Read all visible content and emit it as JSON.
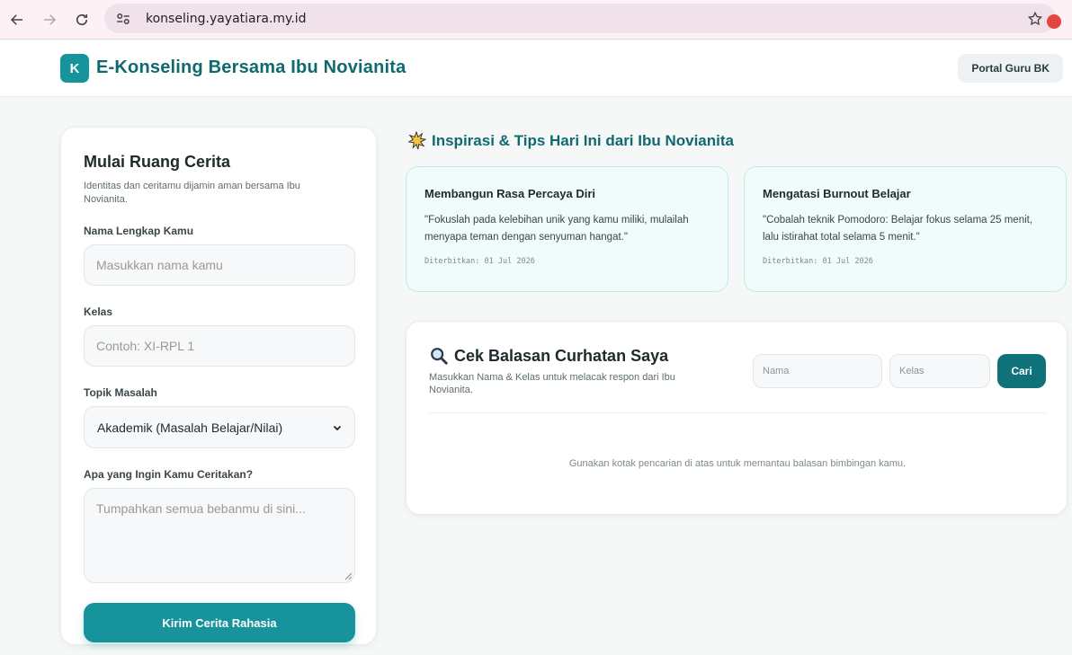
{
  "browser": {
    "url": "konseling.yayatiara.my.id"
  },
  "header": {
    "logo_letter": "K",
    "title": "E-Konseling Bersama Ibu Novianita",
    "portal_button": "Portal Guru BK"
  },
  "form": {
    "title": "Mulai Ruang Cerita",
    "subtitle": "Identitas dan ceritamu dijamin aman bersama Ibu Novianita.",
    "name_label": "Nama Lengkap Kamu",
    "name_placeholder": "Masukkan nama kamu",
    "class_label": "Kelas",
    "class_placeholder": "Contoh: XI-RPL 1",
    "topic_label": "Topik Masalah",
    "topic_selected": "Akademik (Masalah Belajar/Nilai)",
    "story_label": "Apa yang Ingin Kamu Ceritakan?",
    "story_placeholder": "Tumpahkan semua bebanmu di sini...",
    "submit_label": "Kirim Cerita Rahasia"
  },
  "tips": {
    "heading": "Inspirasi & Tips Hari Ini dari Ibu Novianita",
    "heading_icon": "burst-icon",
    "items": [
      {
        "title": "Membangun Rasa Percaya Diri",
        "quote": "\"Fokuslah pada kelebihan unik yang kamu miliki, mulailah menyapa teman dengan senyuman hangat.\"",
        "date": "Diterbitkan: 01 Jul 2026"
      },
      {
        "title": "Mengatasi Burnout Belajar",
        "quote": "\"Cobalah teknik Pomodoro: Belajar fokus selama 25 menit, lalu istirahat total selama 5 menit.\"",
        "date": "Diterbitkan: 01 Jul 2026"
      }
    ]
  },
  "search": {
    "title": "Cek Balasan Curhatan Saya",
    "subtitle": "Masukkan Nama & Kelas untuk melacak respon dari Ibu Novianita.",
    "name_placeholder": "Nama",
    "class_placeholder": "Kelas",
    "button": "Cari",
    "hint": "Gunakan kotak pencarian di atas untuk memantau balasan bimbingan kamu."
  },
  "colors": {
    "primary": "#17939c",
    "primary_dark": "#0f6a70",
    "tip_bg": "#f1fbfb",
    "tip_border": "#bfeaea"
  }
}
